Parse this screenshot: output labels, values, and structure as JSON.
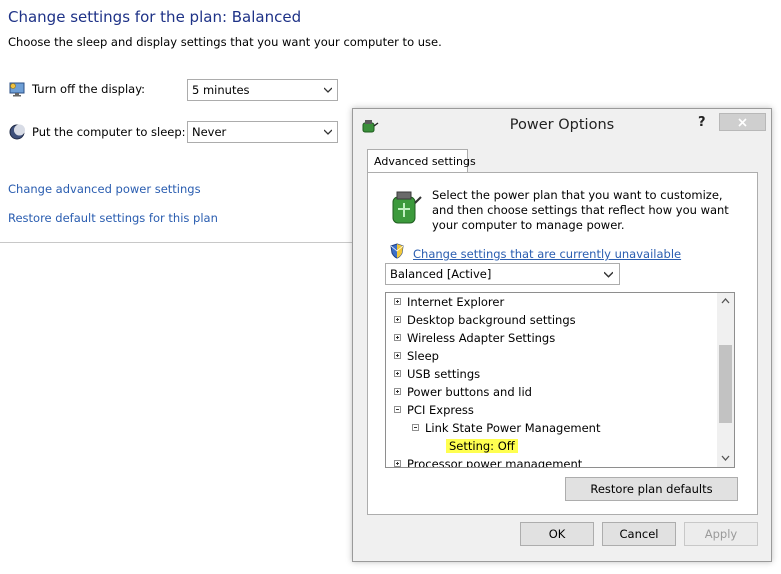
{
  "background": {
    "title": "Change settings for the plan: Balanced",
    "subtitle": "Choose the sleep and display settings that you want your computer to use.",
    "display_row": {
      "label": "Turn off the display:",
      "value": "5 minutes",
      "icon": "monitor-power-icon"
    },
    "sleep_row": {
      "label": "Put the computer to sleep:",
      "value": "Never",
      "icon": "moon-sleep-icon"
    },
    "links": {
      "advanced": "Change advanced power settings",
      "restore": "Restore default settings for this plan"
    }
  },
  "dialog": {
    "title": "Power Options",
    "help_glyph": "?",
    "tab": "Advanced settings",
    "description": "Select the power plan that you want to customize, and then choose settings that reflect how you want your computer to manage power.",
    "unavailable_link": "Change settings that are currently unavailable",
    "plan_select": "Balanced [Active]",
    "tree": [
      {
        "label": "Internet Explorer",
        "expander": "+"
      },
      {
        "label": "Desktop background settings",
        "expander": "+"
      },
      {
        "label": "Wireless Adapter Settings",
        "expander": "+"
      },
      {
        "label": "Sleep",
        "expander": "+"
      },
      {
        "label": "USB settings",
        "expander": "+"
      },
      {
        "label": "Power buttons and lid",
        "expander": "+"
      },
      {
        "label": "PCI Express",
        "expander": "-"
      },
      {
        "label": "Link State Power Management",
        "expander": "-"
      },
      {
        "label": "Setting:  Off",
        "expander": ""
      },
      {
        "label": "Processor power management",
        "expander": "+"
      }
    ],
    "restore_button": "Restore plan defaults",
    "ok_button": "OK",
    "cancel_button": "Cancel",
    "apply_button": "Apply"
  },
  "colors": {
    "title_blue": "#1e3287",
    "link_blue": "#2a5db0",
    "highlight": "#ffff50"
  }
}
